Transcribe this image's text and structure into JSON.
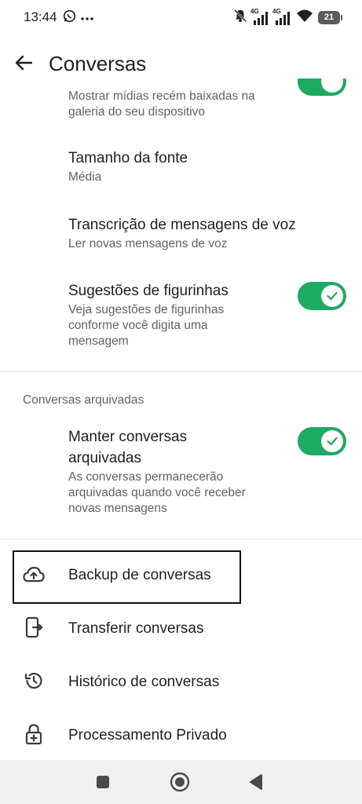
{
  "status_bar": {
    "time": "13:44",
    "left_icons": [
      "whatsapp-icon",
      "more-dots-icon"
    ],
    "network_tag_1": "4G",
    "network_tag_2": "4G",
    "battery_level": "21"
  },
  "header": {
    "title": "Conversas"
  },
  "settings": {
    "media_visibility": {
      "subtitle": "Mostrar mídias recém baixadas na galeria do seu dispositivo",
      "enabled": true
    },
    "font_size": {
      "title": "Tamanho da fonte",
      "subtitle": "Média"
    },
    "voice_transcription": {
      "title": "Transcrição de mensagens de voz",
      "subtitle": "Ler novas mensagens de voz"
    },
    "sticker_suggestions": {
      "title": "Sugestões de figurinhas",
      "subtitle": "Veja sugestões de figurinhas conforme você digita uma mensagem",
      "enabled": true
    }
  },
  "archived": {
    "section_title": "Conversas arquivadas",
    "keep_archived": {
      "title": "Manter conversas arquivadas",
      "subtitle": "As conversas permanecerão arquivadas quando você receber novas mensagens",
      "enabled": true
    }
  },
  "actions": [
    {
      "label": "Backup de conversas",
      "icon": "cloud-upload-icon"
    },
    {
      "label": "Transferir conversas",
      "icon": "phone-transfer-icon"
    },
    {
      "label": "Histórico de conversas",
      "icon": "history-icon"
    },
    {
      "label": "Processamento Privado",
      "icon": "lock-plus-icon"
    }
  ],
  "colors": {
    "toggle_on": "#1daa61",
    "text_primary": "#1f1f1f",
    "text_secondary": "#5e6368"
  }
}
